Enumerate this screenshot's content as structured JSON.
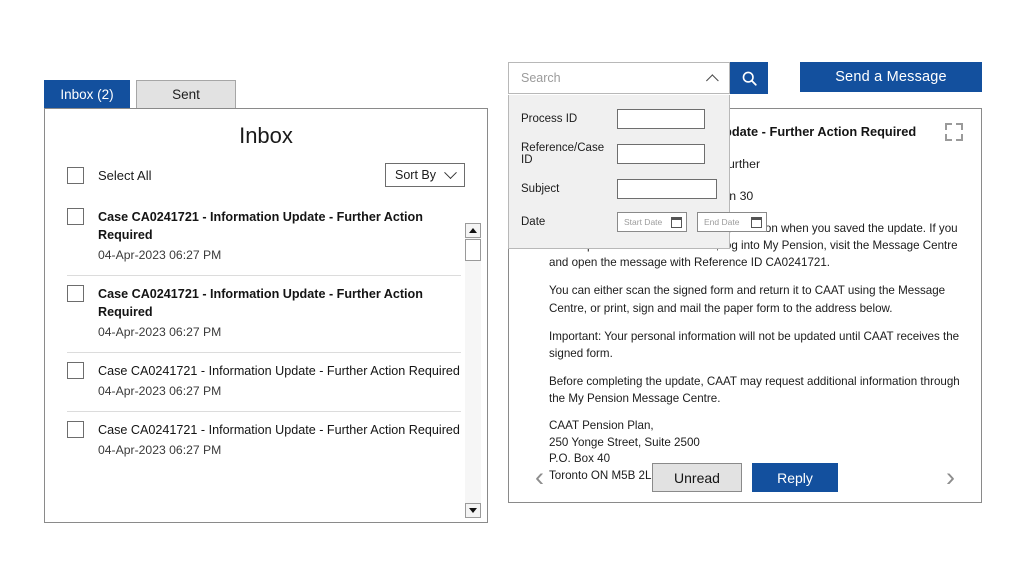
{
  "inbox": {
    "tabs": [
      {
        "label": "Inbox (2)",
        "active": true
      },
      {
        "label": "Sent",
        "active": false
      }
    ],
    "title": "Inbox",
    "select_all_label": "Select All",
    "sort_by_label": "Sort By",
    "messages": [
      {
        "subject": "Case CA0241721 - Information Update - Further Action Required",
        "date": "04-Apr-2023 06:27 PM",
        "unread": true
      },
      {
        "subject": "Case CA0241721 - Information Update - Further Action Required",
        "date": "04-Apr-2023 06:27 PM",
        "unread": true
      },
      {
        "subject": "Case CA0241721 - Information Update - Further Action Required",
        "date": "04-Apr-2023 06:27 PM",
        "unread": false
      },
      {
        "subject": "Case CA0241721 - Information Update - Further Action Required",
        "date": "04-Apr-2023 06:27 PM",
        "unread": false
      }
    ]
  },
  "search": {
    "placeholder": "Search",
    "expanded": true,
    "fields": {
      "process_id_label": "Process ID",
      "process_id_value": "",
      "reference_case_id_label": "Reference/Case ID",
      "reference_case_id_value": "",
      "subject_label": "Subject",
      "subject_value": "",
      "date_label": "Date",
      "start_date_placeholder": "Start Date",
      "start_date_value": "",
      "end_date_placeholder": "End Date",
      "end_date_value": ""
    }
  },
  "toolbar": {
    "send_message_label": "Send a Message"
  },
  "message": {
    "title": "Case CA0241721 - Information Update - Further Action Required",
    "title_visible": "ate - Further Action Required",
    "intro_line_1": "Spouse information in My Pension. Further",
    "intro_line_2": "requires your signed paper form within 30",
    "paragraphs": [
      "The form was provided to you in My Pension when you saved the update. If you did not print the form at that time, log into My Pension, visit the Message Centre and open the message with Reference ID CA0241721.",
      "You can either scan the signed form and return it to CAAT using the Message Centre, or print, sign and mail the paper form to the address below.",
      "Important: Your personal information will not be updated until CAAT receives the signed form.",
      "Before completing the update, CAAT may request additional information through the My Pension Message Centre."
    ],
    "address": [
      "CAAT Pension Plan,",
      "250 Yonge Street, Suite 2500",
      "P.O. Box 40",
      "Toronto ON M5B 2L7 Canada"
    ],
    "footer": {
      "prev_label": "‹",
      "next_label": "›",
      "unread_label": "Unread",
      "reply_label": "Reply"
    }
  },
  "colors": {
    "brand_blue": "#13509e",
    "tab_inactive": "#e2e2e2",
    "border_gray": "#8a8a8a"
  }
}
